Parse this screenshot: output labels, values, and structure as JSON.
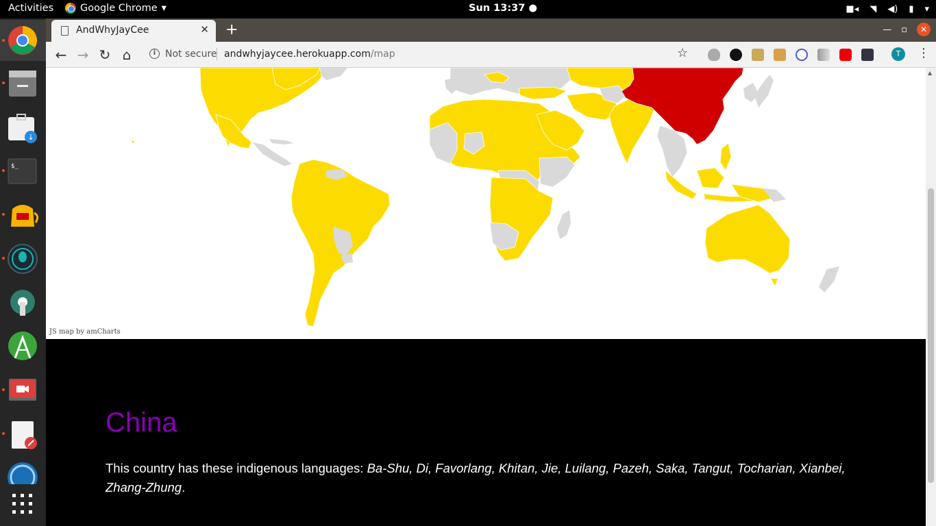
{
  "topbar": {
    "activities": "Activities",
    "app_name": "Google Chrome",
    "clock": "Sun 13:37 ●"
  },
  "browser": {
    "tab_title": "AndWhyJayCee",
    "security_label": "Not secure",
    "url_host": "andwhyjaycee.herokuapp.com",
    "url_path": "/map",
    "profile_initial": "T"
  },
  "map": {
    "credit": "JS map by amCharts",
    "selected_country": "China",
    "colors": {
      "selected": "#d00000",
      "has_languages": "#fcdc00",
      "default": "#d9d9d9",
      "background": "#ffffff"
    }
  },
  "country": {
    "name": "China",
    "intro": "This country has these indigenous languages: ",
    "languages": "Ba-Shu, Di, Favorlang, Khitan, Jie, Luilang, Pazeh, Saka, Tangut, Tocharian, Xianbei, Zhang-Zhung",
    "end": "."
  },
  "dock": {
    "icons": [
      "chrome-icon",
      "files-icon",
      "software-icon",
      "terminal-icon",
      "kettle-icon",
      "gitkraken-icon",
      "settings-icon",
      "android-studio-icon",
      "screen-recorder-icon",
      "text-editor-icon",
      "app-icon",
      "show-apps-icon"
    ]
  }
}
